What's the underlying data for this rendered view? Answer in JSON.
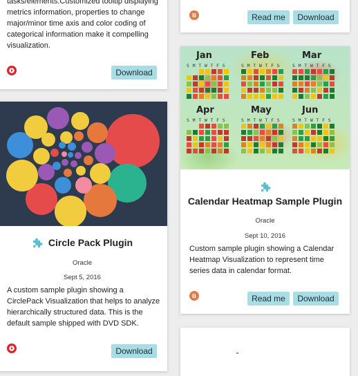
{
  "cards": {
    "top_left": {
      "description": "tasks/elements.Customized tooltip displaying metrics information, properties to change major/minor time axis and color coding of categorical information make it compelling visualization.",
      "download_label": "Download",
      "source_icon": "red-play-circle-icon"
    },
    "top_right": {
      "source_icon": "orange-b-circle-icon",
      "source_glyph": "B",
      "read_label": "Read me",
      "download_label": "Download"
    },
    "circle_pack": {
      "title": "Circle Pack Plugin",
      "author": "Oracle",
      "date": "Sept 5, 2016",
      "description": "A custom sample plugin showing a CirclePack Visualization that helps to analyze hierarchically structured data. This is the default sample shipped with DVD SDK.",
      "download_label": "Download",
      "type_icon": "puzzle-icon",
      "source_icon": "red-play-circle-icon"
    },
    "calendar_heatmap": {
      "title": "Calendar Heatmap Sample Plugin",
      "author": "Oracle",
      "date": "Sept 10, 2016",
      "description": "Custom sample plugin showing a Calendar Heatmap Visualization to represent time series data in calendar format.",
      "read_label": "Read me",
      "download_label": "Download",
      "type_icon": "puzzle-icon",
      "source_icon": "orange-b-circle-icon",
      "source_glyph": "B",
      "months": [
        "Jan",
        "Feb",
        "Mar",
        "Apr",
        "May",
        "Jun"
      ],
      "weekday_header": "S M T W T F S"
    }
  },
  "colors": {
    "button_bg": "#a9dde5",
    "puzzle_icon": "#5bbfd1",
    "red_icon": "#d9262b",
    "orange_icon": "#e07a4a",
    "circle_pack_bg": "#2e3b4e"
  }
}
